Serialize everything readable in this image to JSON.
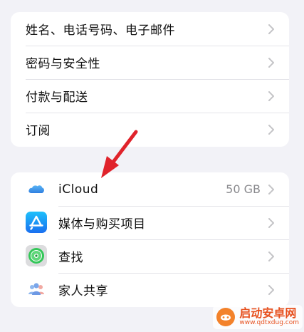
{
  "account_group": {
    "items": [
      {
        "label": "姓名、电话号码、电子邮件"
      },
      {
        "label": "密码与安全性"
      },
      {
        "label": "付款与配送"
      },
      {
        "label": "订阅"
      }
    ]
  },
  "services_group": {
    "items": [
      {
        "label": "iCloud",
        "value": "50 GB",
        "icon": "icloud-icon"
      },
      {
        "label": "媒体与购买项目",
        "icon": "app-store-icon"
      },
      {
        "label": "查找",
        "icon": "find-my-icon"
      },
      {
        "label": "家人共享",
        "icon": "family-sharing-icon"
      }
    ]
  },
  "watermark": {
    "name": "启动安卓网",
    "url": "www.qdtxdug.com"
  },
  "colors": {
    "background": "#f2f2f7",
    "annotation_arrow": "#e0232b",
    "chevron": "#c4c4c7",
    "secondary_text": "#8a8a8e"
  }
}
